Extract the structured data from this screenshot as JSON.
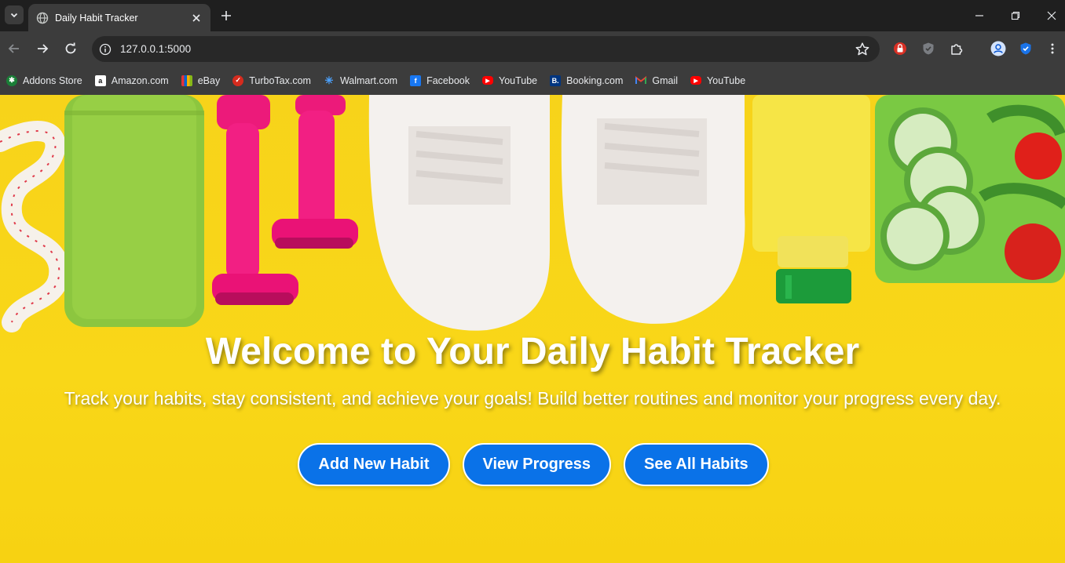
{
  "browser": {
    "tab": {
      "title": "Daily Habit Tracker"
    },
    "address": {
      "url": "127.0.0.1:5000"
    },
    "bookmarks": [
      {
        "label": "Addons Store",
        "icon": "addons-store-icon",
        "color": "#1a7f37"
      },
      {
        "label": "Amazon.com",
        "icon": "amazon-icon",
        "color": "#ffffff"
      },
      {
        "label": "eBay",
        "icon": "ebay-icon",
        "color": "#e53238"
      },
      {
        "label": "TurboTax.com",
        "icon": "turbotax-icon",
        "color": "#d52b1e"
      },
      {
        "label": "Walmart.com",
        "icon": "walmart-icon",
        "color": "#0071ce"
      },
      {
        "label": "Facebook",
        "icon": "facebook-icon",
        "color": "#1877f2"
      },
      {
        "label": "YouTube",
        "icon": "youtube-icon",
        "color": "#ff0000"
      },
      {
        "label": "Booking.com",
        "icon": "booking-icon",
        "color": "#003580"
      },
      {
        "label": "Gmail",
        "icon": "gmail-icon",
        "color": "#ea4335"
      },
      {
        "label": "YouTube",
        "icon": "youtube-icon",
        "color": "#ff0000"
      }
    ]
  },
  "page": {
    "hero": {
      "title": "Welcome to Your Daily Habit Tracker",
      "subtitle": "Track your habits, stay consistent, and achieve your goals! Build better routines and monitor your progress every day."
    },
    "actions": [
      {
        "label": "Add New Habit"
      },
      {
        "label": "View Progress"
      },
      {
        "label": "See All Habits"
      }
    ]
  },
  "colors": {
    "accent_button": "#0a72e8",
    "hero_background": "#f7d31a",
    "chrome_dark": "#1f1f1f",
    "chrome_toolbar": "#3c3c3c"
  }
}
